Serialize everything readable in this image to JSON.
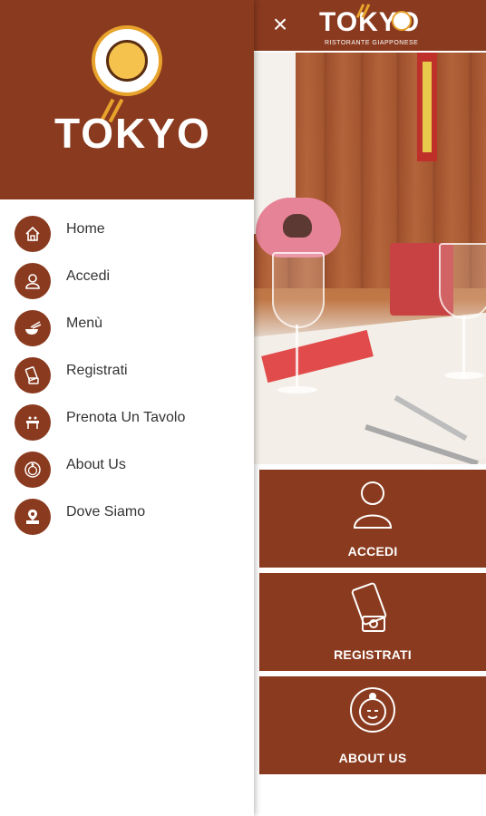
{
  "app": {
    "brand": "TOKYO",
    "brand_subtitle": "RISTORANTE GIAPPONESE",
    "accent_color": "#8a3a1e",
    "logo_accent": "#e8a32c"
  },
  "topbar": {
    "close_icon": "×"
  },
  "drawer": {
    "items": [
      {
        "label": "Home",
        "icon": "home-icon"
      },
      {
        "label": "Accedi",
        "icon": "user-icon"
      },
      {
        "label": "Menù",
        "icon": "chopsticks-bowl-icon"
      },
      {
        "label": "Registrati",
        "icon": "register-icon"
      },
      {
        "label": "Prenota Un Tavolo",
        "icon": "table-icon"
      },
      {
        "label": "About Us",
        "icon": "sumo-face-icon"
      },
      {
        "label": "Dove Siamo",
        "icon": "map-pin-icon"
      }
    ]
  },
  "main": {
    "tiles": [
      {
        "label": "ACCEDI",
        "icon": "user-icon"
      },
      {
        "label": "REGISTRATI",
        "icon": "register-icon"
      },
      {
        "label": "ABOUT US",
        "icon": "sumo-face-icon"
      }
    ]
  }
}
